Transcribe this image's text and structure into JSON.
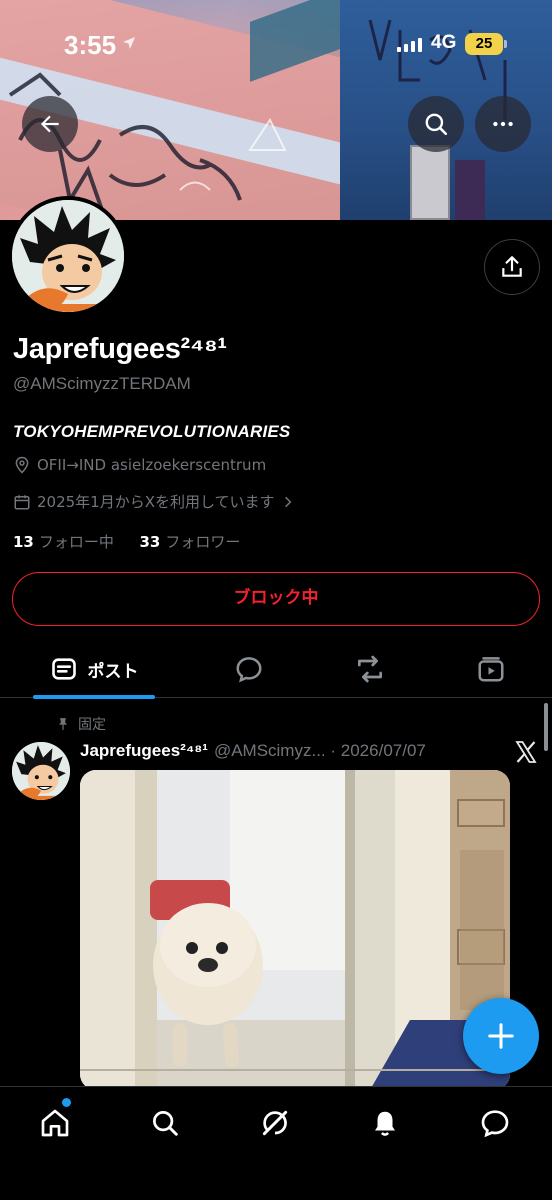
{
  "status_bar": {
    "time": "3:55",
    "network": "4G",
    "battery": "25"
  },
  "profile": {
    "display_name": "Japrefugees²⁴⁸¹",
    "handle": "@AMScimyzzTERDAM",
    "bio": "TOKYOHEMPREVOLUTIONARIES",
    "location": "OFII→IND asielzoekerscentrum",
    "joined": "2025年1月からXを利用しています",
    "following_count": "13",
    "following_label": "フォロー中",
    "followers_count": "33",
    "followers_label": "フォロワー",
    "blocked_button": "ブロック中"
  },
  "tabs": {
    "posts_label": "ポスト"
  },
  "post": {
    "pinned_label": "固定",
    "author_name": "Japrefugees²⁴⁸¹",
    "author_handle": "@AMScimyz...",
    "date": "· 2026/07/07"
  },
  "icons": {
    "back": "arrow-left-icon",
    "search": "search-icon",
    "more": "more-icon",
    "share": "share-icon",
    "location": "location-pin-icon",
    "calendar": "calendar-icon",
    "chevron": "chevron-right-icon",
    "tab_posts": "posts-icon",
    "tab_replies": "reply-icon",
    "tab_reposts": "repost-icon",
    "tab_media": "media-icon",
    "pin": "pin-icon",
    "x_logo": "x-logo-icon",
    "compose": "plus-icon",
    "nav_home": "home-icon",
    "nav_search": "search-icon",
    "nav_grok": "grok-icon",
    "nav_notifications": "bell-icon",
    "nav_messages": "message-icon"
  },
  "colors": {
    "accent": "#1d9bf0",
    "blocked": "#f4212e",
    "secondary_text": "#71767b",
    "background": "#000000"
  }
}
